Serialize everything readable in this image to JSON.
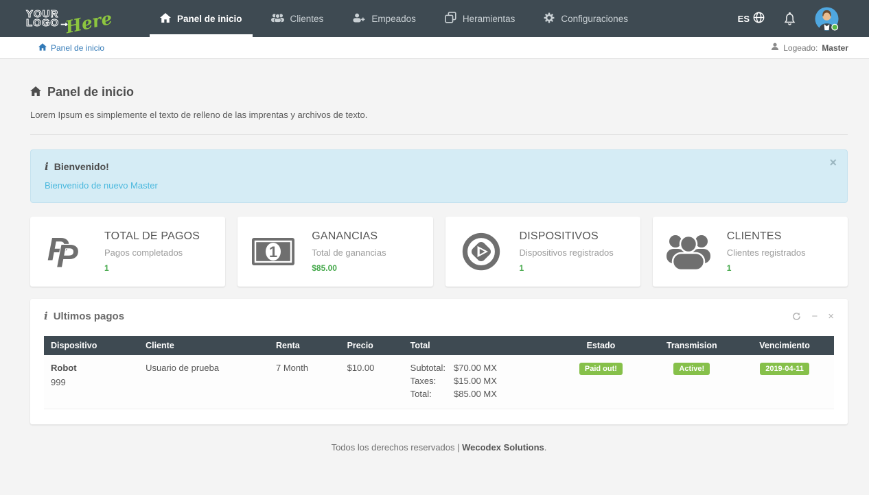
{
  "navbar": {
    "logo": {
      "line1": "YOUR",
      "line2": "LOGO→",
      "script": "Here"
    },
    "items": [
      {
        "label": "Panel de inicio",
        "icon": "home-icon",
        "active": true
      },
      {
        "label": "Clientes",
        "icon": "users-icon",
        "active": false
      },
      {
        "label": "Empeados",
        "icon": "user-plus-icon",
        "active": false
      },
      {
        "label": "Heramientas",
        "icon": "clone-icon",
        "active": false
      },
      {
        "label": "Configuraciones",
        "icon": "gear-icon",
        "active": false
      }
    ],
    "language": "ES"
  },
  "breadcrumb": {
    "item": "Panel de inicio",
    "logged_label": "Logeado:",
    "logged_user": "Master"
  },
  "page": {
    "title": "Panel de inicio",
    "subtitle": "Lorem Ipsum es simplemente el texto de relleno de las imprentas y archivos de texto."
  },
  "alert": {
    "title": "Bienvenido!",
    "message": "Bienvenido de nuevo Master"
  },
  "stats": [
    {
      "icon": "paypal-icon",
      "title": "TOTAL DE PAGOS",
      "subtitle": "Pagos completados",
      "value": "1"
    },
    {
      "icon": "money-bill-icon",
      "title": "GANANCIAS",
      "subtitle": "Total de ganancias",
      "value": "$85.00"
    },
    {
      "icon": "device-play-icon",
      "title": "DISPOSITIVOS",
      "subtitle": "Dispositivos registrados",
      "value": "1"
    },
    {
      "icon": "group-icon",
      "title": "CLIENTES",
      "subtitle": "Clientes registrados",
      "value": "1"
    }
  ],
  "panel": {
    "title": "Ultimos pagos",
    "table": {
      "headers": [
        "Dispositivo",
        "Cliente",
        "Renta",
        "Precio",
        "Total",
        "Estado",
        "Transmision",
        "Vencimiento"
      ],
      "row": {
        "device_name": "Robot",
        "device_id": "999",
        "client": "Usuario de prueba",
        "rent": "7 Month",
        "price": "$10.00",
        "totals": [
          {
            "label": "Subtotal:",
            "value": "$70.00 MX"
          },
          {
            "label": "Taxes:",
            "value": "$15.00 MX"
          },
          {
            "label": "Total:",
            "value": "$85.00 MX"
          }
        ],
        "status": "Paid out!",
        "transmission": "Active!",
        "due_date": "2019-04-11"
      }
    }
  },
  "footer": {
    "prefix": "Todos los derechos reservados |",
    "brand": "Wecodex Solutions",
    "suffix": "."
  },
  "icons": {
    "info": "i",
    "close": "×",
    "collapse": "−"
  },
  "colors": {
    "navbar": "#3e4a52",
    "accent_blue": "#337ab7",
    "alert_bg": "#d5ecf5",
    "alert_link": "#4cb9de",
    "success_green": "#46a94c",
    "badge_green": "#86c04a",
    "logo_green": "#8dc63f"
  }
}
